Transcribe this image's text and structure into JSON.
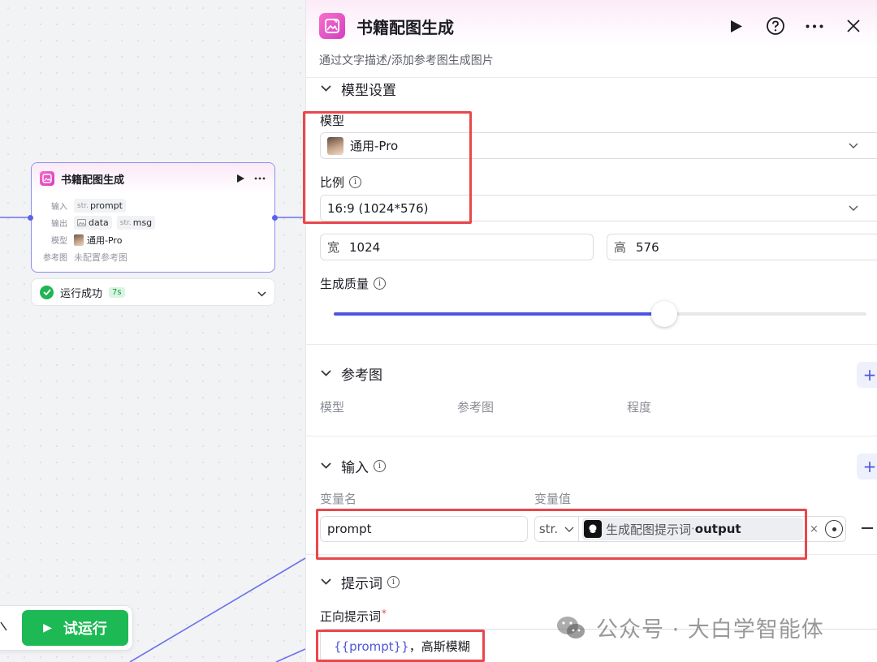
{
  "node": {
    "title": "书籍配图生成",
    "rows": {
      "input_label": "输入",
      "input_tags": [
        {
          "type": "str.",
          "name": "prompt"
        }
      ],
      "output_label": "输出",
      "output_tags": [
        {
          "type": "image",
          "name": "data"
        },
        {
          "type": "str.",
          "name": "msg"
        }
      ],
      "model_label": "模型",
      "model_value": "通用-Pro",
      "ref_label": "参考图",
      "ref_value": "未配置参考图"
    }
  },
  "status": {
    "text": "运行成功",
    "duration": "7s"
  },
  "toolbar": {
    "run_label": "试运行"
  },
  "panel": {
    "title": "书籍配图生成",
    "description": "通过文字描述/添加参考图生成图片",
    "model_settings": {
      "section_title": "模型设置",
      "model_label": "模型",
      "model_value": "通用-Pro",
      "ratio_label": "比例",
      "ratio_value": "16:9 (1024*576)",
      "width_prefix": "宽",
      "width_value": "1024",
      "height_prefix": "高",
      "height_value": "576",
      "quality_label": "生成质量",
      "quality_fraction": 0.62
    },
    "reference": {
      "section_title": "参考图",
      "columns": [
        "模型",
        "参考图",
        "程度"
      ]
    },
    "inputs": {
      "section_title": "输入",
      "col_name": "变量名",
      "col_value": "变量值",
      "row": {
        "name": "prompt",
        "type": "str.",
        "ref_node": "生成配图提示词",
        "ref_sep": " · ",
        "ref_field": "output"
      }
    },
    "prompt": {
      "section_title": "提示词",
      "positive_label": "正向提示词",
      "required_mark": "*",
      "var": "{{prompt}}",
      "rest": "，高斯模糊"
    }
  },
  "watermark": {
    "text": "公众号 · 大白学智能体"
  },
  "colors": {
    "accent": "#4d55e0",
    "success": "#1db954",
    "annotation": "#e9474c",
    "brand_pink": "#e04fc6"
  }
}
